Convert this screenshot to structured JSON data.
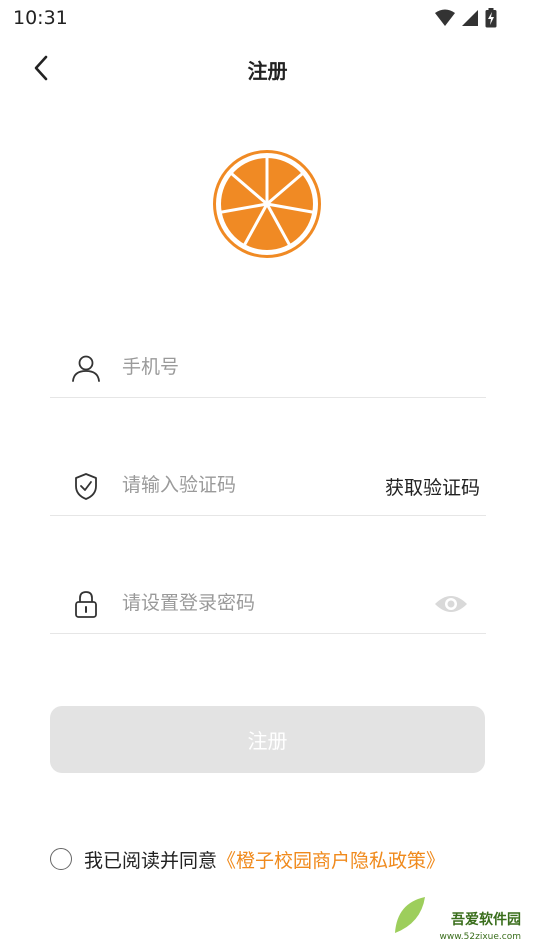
{
  "status_bar": {
    "time": "10:31",
    "icons": [
      "wifi-icon",
      "signal-icon",
      "battery-charging-icon"
    ]
  },
  "header": {
    "back_icon": "chevron-left-icon",
    "title": "注册"
  },
  "logo": {
    "icon": "orange-slice-logo",
    "color": "#f08a24"
  },
  "form": {
    "phone": {
      "icon": "user-icon",
      "placeholder": "手机号",
      "value": ""
    },
    "code": {
      "icon": "shield-check-icon",
      "placeholder": "请输入验证码",
      "value": "",
      "get_code_label": "获取验证码"
    },
    "password": {
      "icon": "lock-icon",
      "placeholder": "请设置登录密码",
      "value": "",
      "toggle_icon": "eye-icon"
    }
  },
  "register_button": {
    "label": "注册",
    "background": "#e3e3e3"
  },
  "agreement": {
    "checked": false,
    "text": "我已阅读并同意",
    "link": "《橙子校园商户隐私政策》",
    "link_color": "#f08a1c"
  },
  "watermark": {
    "text": "吾爱软件园",
    "url": "www.52zixue.com"
  }
}
